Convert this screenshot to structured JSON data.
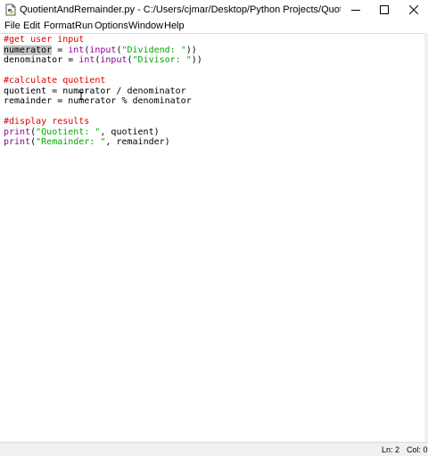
{
  "window": {
    "title": "QuotientAndRemainder.py - C:/Users/cjmar/Desktop/Python Projects/QuotientAndRemainde...",
    "app_icon": "python-file-icon",
    "controls": [
      "minimize-icon",
      "maximize-icon",
      "close-icon"
    ]
  },
  "menu": {
    "items": [
      "File",
      "Edit",
      "Format",
      "Run",
      "Options",
      "Window",
      "Help"
    ]
  },
  "editor": {
    "colors": {
      "comment": "#dd0000",
      "builtin": "#900090",
      "string": "#00aa00",
      "default": "#000000",
      "selection": "#c3c3c3"
    },
    "lines": [
      {
        "tokens": [
          {
            "t": "#get user input",
            "c": "comment"
          }
        ]
      },
      {
        "tokens": [
          {
            "t": "numerator",
            "c": "sel"
          },
          {
            "t": " = ",
            "c": "default"
          },
          {
            "t": "int",
            "c": "builtin"
          },
          {
            "t": "(",
            "c": "default"
          },
          {
            "t": "input",
            "c": "builtin"
          },
          {
            "t": "(",
            "c": "default"
          },
          {
            "t": "\"Dividend: \"",
            "c": "string"
          },
          {
            "t": "))",
            "c": "default"
          }
        ]
      },
      {
        "tokens": [
          {
            "t": "denominator = ",
            "c": "default"
          },
          {
            "t": "int",
            "c": "builtin"
          },
          {
            "t": "(",
            "c": "default"
          },
          {
            "t": "input",
            "c": "builtin"
          },
          {
            "t": "(",
            "c": "default"
          },
          {
            "t": "\"Divisor: \"",
            "c": "string"
          },
          {
            "t": "))",
            "c": "default"
          }
        ]
      },
      {
        "tokens": []
      },
      {
        "tokens": [
          {
            "t": "#calculate quotient",
            "c": "comment"
          }
        ]
      },
      {
        "tokens": [
          {
            "t": "quotient = numerator / denominator",
            "c": "default"
          }
        ]
      },
      {
        "tokens": [
          {
            "t": "remainder = numerator % denominator",
            "c": "default"
          }
        ]
      },
      {
        "tokens": []
      },
      {
        "tokens": [
          {
            "t": "#display results",
            "c": "comment"
          }
        ]
      },
      {
        "tokens": [
          {
            "t": "print",
            "c": "builtin"
          },
          {
            "t": "(",
            "c": "default"
          },
          {
            "t": "\"Quotient: \"",
            "c": "string"
          },
          {
            "t": ", quotient)",
            "c": "default"
          }
        ]
      },
      {
        "tokens": [
          {
            "t": "print",
            "c": "builtin"
          },
          {
            "t": "(",
            "c": "default"
          },
          {
            "t": "\"Remainder: \"",
            "c": "string"
          },
          {
            "t": ", remainder)",
            "c": "default"
          }
        ]
      }
    ]
  },
  "status": {
    "line": "Ln: 2",
    "column": "Col: 0"
  }
}
